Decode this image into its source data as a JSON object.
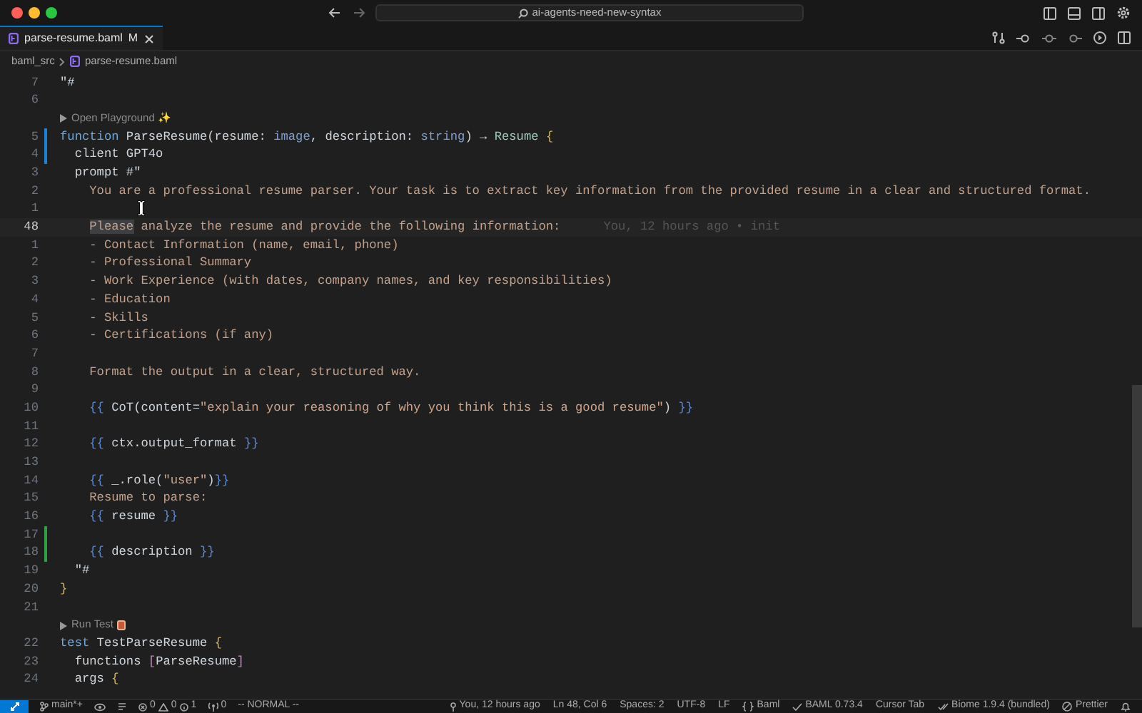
{
  "command_center": {
    "text": "ai-agents-need-new-syntax"
  },
  "tabs": [
    {
      "label": "parse-resume.baml",
      "badge": "M",
      "selected": true
    }
  ],
  "breadcrumb": [
    "baml_src",
    "parse-resume.baml"
  ],
  "editor": {
    "lines": [
      {
        "kind": "code",
        "number": "7",
        "segments": [
          {
            "kind": "plain",
            "text": "\"#"
          }
        ]
      },
      {
        "kind": "code",
        "number": "6"
      },
      {
        "kind": "lens",
        "label": "Open Playground ✨"
      },
      {
        "kind": "code",
        "number": "5",
        "modified": true,
        "segments": [
          {
            "kind": "keyword",
            "text": "function"
          },
          {
            "kind": "plain",
            "text": " ParseResume(resume: "
          },
          {
            "kind": "type",
            "text": "image"
          },
          {
            "kind": "plain",
            "text": ", description: "
          },
          {
            "kind": "type",
            "text": "string"
          },
          {
            "kind": "plain",
            "text": ") → "
          },
          {
            "kind": "class",
            "text": "Resume"
          },
          {
            "kind": "bracket",
            "text": " {"
          }
        ]
      },
      {
        "kind": "code",
        "number": "4",
        "modified": true,
        "segments": [
          {
            "kind": "plain",
            "text": "  client GPT4o"
          }
        ]
      },
      {
        "kind": "code",
        "number": "3",
        "segments": [
          {
            "kind": "plain",
            "text": "  prompt #\""
          }
        ]
      },
      {
        "kind": "code",
        "number": "2",
        "segments": [
          {
            "kind": "prompt",
            "text": "    You are a professional resume parser. Your task is to extract key information from the provided resume in a clear and structured format."
          }
        ]
      },
      {
        "kind": "code",
        "number": "1"
      },
      {
        "kind": "code",
        "number": "48",
        "current": true,
        "segments": [
          {
            "kind": "selection",
            "text": "    Please"
          },
          {
            "kind": "prompt",
            "text": " analyze the resume and provide the following information:"
          }
        ],
        "annotation": "You, 12 hours ago • init"
      },
      {
        "kind": "code",
        "number": "1",
        "segments": [
          {
            "kind": "prompt",
            "text": "    - Contact Information (name, email, phone)"
          }
        ]
      },
      {
        "kind": "code",
        "number": "2",
        "segments": [
          {
            "kind": "prompt",
            "text": "    - Professional Summary"
          }
        ]
      },
      {
        "kind": "code",
        "number": "3",
        "segments": [
          {
            "kind": "prompt",
            "text": "    - Work Experience (with dates, company names, and key responsibilities)"
          }
        ]
      },
      {
        "kind": "code",
        "number": "4",
        "segments": [
          {
            "kind": "prompt",
            "text": "    - Education"
          }
        ]
      },
      {
        "kind": "code",
        "number": "5",
        "segments": [
          {
            "kind": "prompt",
            "text": "    - Skills"
          }
        ]
      },
      {
        "kind": "code",
        "number": "6",
        "segments": [
          {
            "kind": "prompt",
            "text": "    - Certifications (if any)"
          }
        ]
      },
      {
        "kind": "code",
        "number": "7"
      },
      {
        "kind": "code",
        "number": "8",
        "segments": [
          {
            "kind": "prompt",
            "text": "    Format the output in a clear, structured way."
          }
        ]
      },
      {
        "kind": "code",
        "number": "9"
      },
      {
        "kind": "code",
        "number": "10",
        "segments": [
          {
            "kind": "template",
            "text": "    {{"
          },
          {
            "kind": "plain",
            "text": " CoT(content="
          },
          {
            "kind": "string",
            "text": "\"explain your reasoning of why you think this is a good resume\""
          },
          {
            "kind": "plain",
            "text": ")"
          },
          {
            "kind": "template",
            "text": " }}"
          }
        ]
      },
      {
        "kind": "code",
        "number": "11"
      },
      {
        "kind": "code",
        "number": "12",
        "segments": [
          {
            "kind": "template",
            "text": "    {{"
          },
          {
            "kind": "plain",
            "text": " ctx.output_format "
          },
          {
            "kind": "template",
            "text": "}}"
          }
        ]
      },
      {
        "kind": "code",
        "number": "13"
      },
      {
        "kind": "code",
        "number": "14",
        "segments": [
          {
            "kind": "template",
            "text": "    {{"
          },
          {
            "kind": "plain",
            "text": " _.role("
          },
          {
            "kind": "string",
            "text": "\"user\""
          },
          {
            "kind": "plain",
            "text": ")"
          },
          {
            "kind": "template",
            "text": "}}"
          }
        ]
      },
      {
        "kind": "code",
        "number": "15",
        "segments": [
          {
            "kind": "prompt",
            "text": "    Resume to parse:"
          }
        ]
      },
      {
        "kind": "code",
        "number": "16",
        "segments": [
          {
            "kind": "template",
            "text": "    {{"
          },
          {
            "kind": "plain",
            "text": " resume "
          },
          {
            "kind": "template",
            "text": "}}"
          }
        ]
      },
      {
        "kind": "code",
        "number": "17",
        "added": true
      },
      {
        "kind": "code",
        "number": "18",
        "added": true,
        "segments": [
          {
            "kind": "template",
            "text": "    {{"
          },
          {
            "kind": "plain",
            "text": " description "
          },
          {
            "kind": "template",
            "text": "}}"
          }
        ]
      },
      {
        "kind": "code",
        "number": "19",
        "segments": [
          {
            "kind": "plain",
            "text": "  \"#"
          }
        ]
      },
      {
        "kind": "code",
        "number": "20",
        "segments": [
          {
            "kind": "bracket",
            "text": "}"
          }
        ]
      },
      {
        "kind": "code",
        "number": "21"
      },
      {
        "kind": "lens",
        "label": "Run Test"
      },
      {
        "kind": "code",
        "number": "22",
        "segments": [
          {
            "kind": "keyword",
            "text": "test"
          },
          {
            "kind": "plain",
            "text": " TestParseResume "
          },
          {
            "kind": "bracket",
            "text": "{"
          }
        ]
      },
      {
        "kind": "code",
        "number": "23",
        "segments": [
          {
            "kind": "plain",
            "text": "  functions "
          },
          {
            "kind": "bracket2",
            "text": "["
          },
          {
            "kind": "plain",
            "text": "ParseResume"
          },
          {
            "kind": "bracket2",
            "text": "]"
          }
        ]
      },
      {
        "kind": "code",
        "number": "24",
        "segments": [
          {
            "kind": "plain",
            "text": "  args "
          },
          {
            "kind": "bracket",
            "text": "{"
          }
        ]
      }
    ]
  },
  "status_bar": {
    "left": [
      {
        "kind": "remote"
      },
      {
        "kind": "branch",
        "text": "main*+"
      },
      {
        "kind": "preview"
      },
      {
        "kind": "sync"
      },
      {
        "kind": "problems",
        "errors": "0",
        "warnings": "0",
        "infos": "1"
      },
      {
        "kind": "ports",
        "text": "0"
      },
      {
        "kind": "plain",
        "text": "-- NORMAL --"
      }
    ],
    "right": [
      {
        "kind": "blame",
        "text": "You, 12 hours ago"
      },
      {
        "kind": "plain",
        "text": "Ln 48, Col 6"
      },
      {
        "kind": "plain",
        "text": "Spaces: 2"
      },
      {
        "kind": "plain",
        "text": "UTF-8"
      },
      {
        "kind": "plain",
        "text": "LF"
      },
      {
        "kind": "language",
        "text": "Baml"
      },
      {
        "kind": "check",
        "text": "BAML 0.73.4"
      },
      {
        "kind": "plain",
        "text": "Cursor Tab"
      },
      {
        "kind": "biome",
        "text": "Biome 1.9.4 (bundled)"
      },
      {
        "kind": "prettier",
        "text": "Prettier"
      },
      {
        "kind": "bell"
      }
    ]
  }
}
